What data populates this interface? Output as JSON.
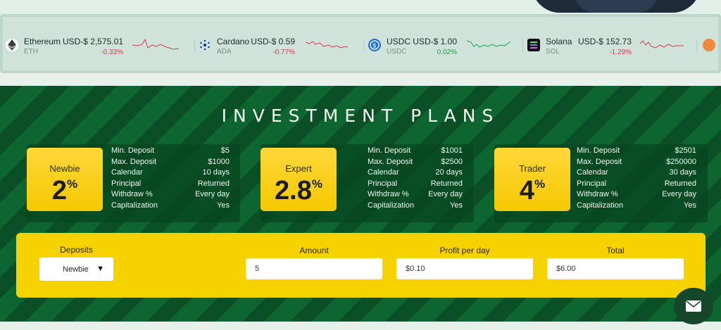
{
  "ticker": [
    {
      "name": "Ethereum",
      "symbol": "ETH",
      "price": "USD-$ 2,575.01",
      "change": "-0.33%",
      "trend": "neg",
      "icon": "ethereum-icon",
      "color": "#3c3c3d"
    },
    {
      "name": "Cardano",
      "symbol": "ADA",
      "price": "USD-$ 0.59",
      "change": "-0.77%",
      "trend": "neg",
      "icon": "cardano-icon",
      "color": "#0033ad"
    },
    {
      "name": "USDC",
      "symbol": "USDC",
      "price": "USD-$ 1.00",
      "change": "0.02%",
      "trend": "pos",
      "icon": "usdc-icon",
      "color": "#2775ca"
    },
    {
      "name": "Solana",
      "symbol": "SOL",
      "price": "USD-$ 152.73",
      "change": "-1.29%",
      "trend": "neg",
      "icon": "solana-icon",
      "color": "#111111"
    }
  ],
  "plans": {
    "title": "INVESTMENT PLANS",
    "items": [
      {
        "name": "Newbie",
        "rate": "2",
        "unit": "%",
        "details": [
          {
            "label": "Min. Deposit",
            "value": "$5"
          },
          {
            "label": "Max. Deposit",
            "value": "$1000"
          },
          {
            "label": "Calendar",
            "value": "10 days"
          },
          {
            "label": "Principal",
            "value": "Returned"
          },
          {
            "label": "Withdraw %",
            "value": "Every day"
          },
          {
            "label": "Capitalization",
            "value": "Yes"
          }
        ]
      },
      {
        "name": "Expert",
        "rate": "2.8",
        "unit": "%",
        "details": [
          {
            "label": "Min. Deposit",
            "value": "$1001"
          },
          {
            "label": "Max. Deposit",
            "value": "$2500"
          },
          {
            "label": "Calendar",
            "value": "20 days"
          },
          {
            "label": "Principal",
            "value": "Returned"
          },
          {
            "label": "Withdraw %",
            "value": "Every day"
          },
          {
            "label": "Capitalization",
            "value": "Yes"
          }
        ]
      },
      {
        "name": "Trader",
        "rate": "4",
        "unit": "%",
        "details": [
          {
            "label": "Min. Deposit",
            "value": "$2501"
          },
          {
            "label": "Max. Deposit",
            "value": "$250000"
          },
          {
            "label": "Calendar",
            "value": "30 days"
          },
          {
            "label": "Principal",
            "value": "Returned"
          },
          {
            "label": "Withdraw %",
            "value": "Every day"
          },
          {
            "label": "Capitalization",
            "value": "Yes"
          }
        ]
      }
    ]
  },
  "calculator": {
    "deposits_label": "Deposits",
    "deposits_selected": "Newbie",
    "amount_label": "Amount",
    "amount_value": "5",
    "profit_label": "Profit per day",
    "profit_value": "$0.10",
    "total_label": "Total",
    "total_value": "$6.00"
  },
  "colors": {
    "section_green": "#0c5c2b",
    "accent_yellow": "#f5d200",
    "negative": "#d6394a",
    "positive": "#16a34a"
  }
}
